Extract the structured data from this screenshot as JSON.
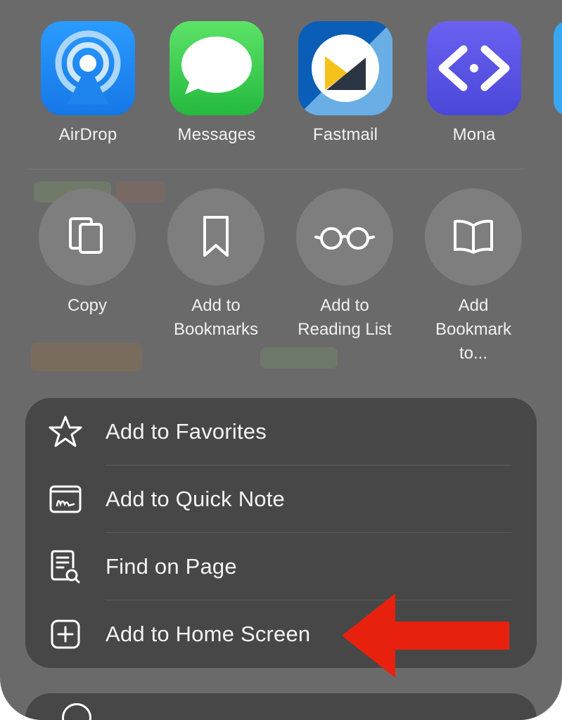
{
  "share_sheet": {
    "apps": [
      {
        "label": "AirDrop",
        "icon": "airdrop-icon"
      },
      {
        "label": "Messages",
        "icon": "messages-icon"
      },
      {
        "label": "Fastmail",
        "icon": "fastmail-icon"
      },
      {
        "label": "Mona",
        "icon": "mona-icon"
      }
    ],
    "actions": [
      {
        "label": "Copy",
        "icon": "copy-icon"
      },
      {
        "label": "Add to\nBookmarks",
        "icon": "bookmark-icon"
      },
      {
        "label": "Add to\nReading List",
        "icon": "glasses-icon"
      },
      {
        "label": "Add\nBookmark\nto...",
        "icon": "book-icon"
      }
    ],
    "menu": [
      {
        "label": "Add to Favorites",
        "icon": "star-icon"
      },
      {
        "label": "Add to Quick Note",
        "icon": "quick-note-icon"
      },
      {
        "label": "Find on Page",
        "icon": "find-on-page-icon"
      },
      {
        "label": "Add to Home Screen",
        "icon": "add-square-icon"
      }
    ]
  },
  "annotation": {
    "color": "#e8210f",
    "icon": "red-arrow"
  },
  "colors": {
    "sheet": "#6a6a6a",
    "menu": "#474747",
    "airdrop": "#1f8bf5",
    "messages": "#3fd257",
    "mona": "#5a55e6"
  }
}
